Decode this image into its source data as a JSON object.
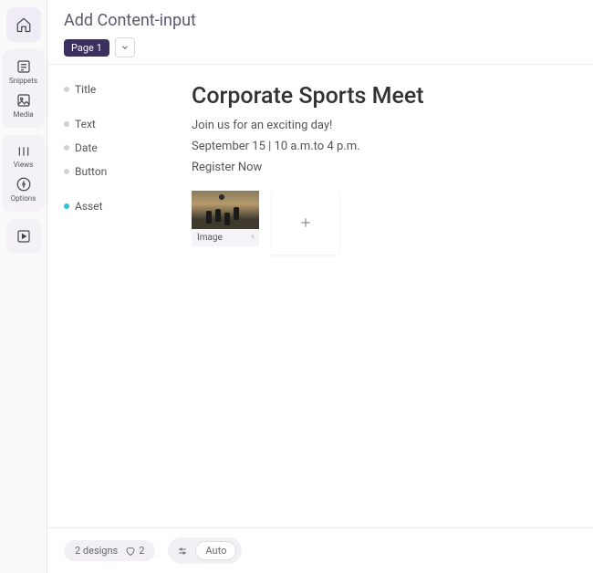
{
  "sidebar": {
    "items": [
      {
        "label": "Snippets"
      },
      {
        "label": "Media"
      },
      {
        "label": "Views"
      },
      {
        "label": "Options"
      }
    ]
  },
  "header": {
    "title": "Add Content-input",
    "page_badge": "Page 1"
  },
  "fields": [
    {
      "label": "Title",
      "active": false
    },
    {
      "label": "Text",
      "active": false
    },
    {
      "label": "Date",
      "active": false
    },
    {
      "label": "Button",
      "active": false
    },
    {
      "label": "Asset",
      "active": true
    }
  ],
  "preview": {
    "title": "Corporate Sports Meet",
    "text": "Join us for an exciting day!",
    "date": "September 15 | 10 a.m.to 4 p.m.",
    "button": "Register Now",
    "asset_caption": "Image"
  },
  "footer": {
    "designs_label": "2 designs",
    "fav_count": "2",
    "auto_label": "Auto"
  }
}
